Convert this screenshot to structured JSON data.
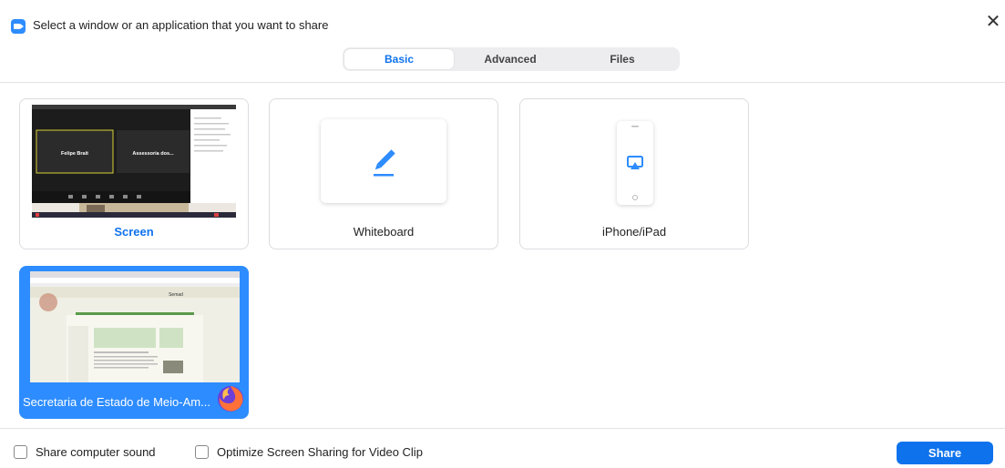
{
  "window": {
    "title": "Select a window or an application that you want to share",
    "close_glyph": "✕"
  },
  "tabs": [
    {
      "label": "Basic",
      "active": true
    },
    {
      "label": "Advanced",
      "active": false
    },
    {
      "label": "Files",
      "active": false
    }
  ],
  "tiles": {
    "screen": {
      "label": "Screen",
      "thumb_left_name": "Felipe Brait",
      "thumb_right_name": "Assessoria dos..."
    },
    "whiteboard": {
      "label": "Whiteboard"
    },
    "iphone": {
      "label": "iPhone/iPad"
    },
    "browser": {
      "label": "Secretaria de Estado de Meio-Am...",
      "thumb_site_title": "Semad"
    }
  },
  "footer": {
    "share_sound_label": "Share computer sound",
    "optimize_label": "Optimize Screen Sharing for Video Clip",
    "share_button": "Share"
  },
  "icons": {
    "app": "zoom-camera-icon",
    "whiteboard": "pen-icon",
    "iphone": "airplay-icon",
    "browser": "firefox-icon"
  },
  "colors": {
    "accent": "#0e72ed",
    "selection": "#2d8cff"
  }
}
